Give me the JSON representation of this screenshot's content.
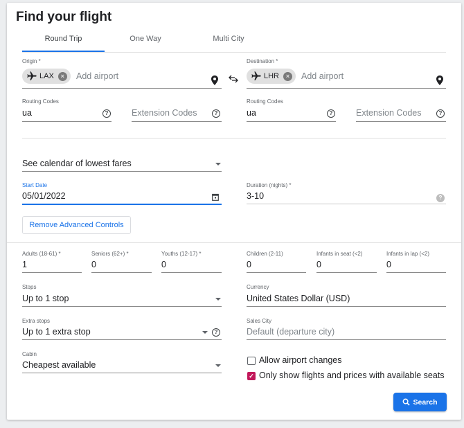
{
  "title": "Find your flight",
  "tabs": [
    {
      "label": "Round Trip",
      "active": true
    },
    {
      "label": "One Way",
      "active": false
    },
    {
      "label": "Multi City",
      "active": false
    }
  ],
  "origin": {
    "label": "Origin *",
    "chip": "LAX",
    "placeholder": "Add airport"
  },
  "destination": {
    "label": "Destination *",
    "chip": "LHR",
    "placeholder": "Add airport"
  },
  "routing_left": {
    "label": "Routing Codes",
    "value": "ua",
    "extension_placeholder": "Extension Codes"
  },
  "routing_right": {
    "label": "Routing Codes",
    "value": "ua",
    "extension_placeholder": "Extension Codes"
  },
  "calendar_select": {
    "value": "See calendar of lowest fares"
  },
  "start_date": {
    "label": "Start Date",
    "value": "05/01/2022"
  },
  "duration": {
    "label": "Duration (nights) *",
    "value": "3-10"
  },
  "remove_advanced": "Remove Advanced Controls",
  "passengers": [
    {
      "label": "Adults (18-61) *",
      "value": "1"
    },
    {
      "label": "Seniors (62+) *",
      "value": "0"
    },
    {
      "label": "Youths (12-17) *",
      "value": "0"
    },
    {
      "label": "Children (2-11)",
      "value": "0"
    },
    {
      "label": "Infants in seat (<2)",
      "value": "0"
    },
    {
      "label": "Infants in lap (<2)",
      "value": "0"
    }
  ],
  "stops": {
    "label": "Stops",
    "value": "Up to 1 stop"
  },
  "currency": {
    "label": "Currency",
    "value": "United States Dollar (USD)"
  },
  "extra_stops": {
    "label": "Extra stops",
    "value": "Up to 1 extra stop"
  },
  "sales_city": {
    "label": "Sales City",
    "placeholder": "Default (departure city)"
  },
  "cabin": {
    "label": "Cabin",
    "value": "Cheapest available"
  },
  "allow_airport_changes": {
    "label": "Allow airport changes",
    "checked": false
  },
  "only_available_seats": {
    "label": "Only show flights and prices with available seats",
    "checked": true
  },
  "search_button": "Search",
  "colors": {
    "accent": "#1a73e8",
    "checkbox_checked": "#c2185b"
  }
}
